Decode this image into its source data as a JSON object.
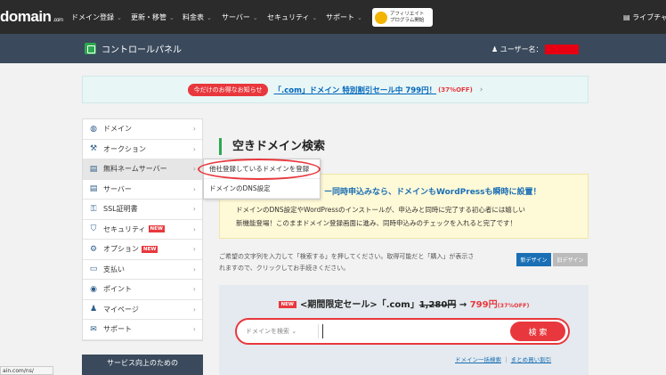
{
  "topnav": {
    "logo_main": "domain",
    "logo_sub": ".com",
    "items": [
      {
        "label": "ドメイン登録"
      },
      {
        "label": "更新・移管"
      },
      {
        "label": "料金表"
      },
      {
        "label": "サーバー"
      },
      {
        "label": "セキュリティ"
      },
      {
        "label": "サポート"
      }
    ],
    "affiliate_line1": "アフィリエイト",
    "affiliate_line2": "プログラム開始",
    "blog": "ライブチャット"
  },
  "cpbar": {
    "title": "コントロールパネル",
    "user_label": "ユーザー名："
  },
  "promo": {
    "badge": "今だけのお得なお知らせ",
    "text": "「.com」ドメイン 特別割引セール中 799円！",
    "off": "(37%OFF)",
    "arrow": "›"
  },
  "sidebar": {
    "items": [
      {
        "label": "ドメイン",
        "icon": "com-icon",
        "glyph": "◍"
      },
      {
        "label": "オークション",
        "icon": "gavel-icon",
        "glyph": "⚒"
      },
      {
        "label": "無料ネームサーバー",
        "icon": "server-icon",
        "glyph": "▤"
      },
      {
        "label": "サーバー",
        "icon": "server-icon",
        "glyph": "▤"
      },
      {
        "label": "SSL証明書",
        "icon": "lock-icon",
        "glyph": "⚿"
      },
      {
        "label": "セキュリティ",
        "icon": "shield-icon",
        "glyph": "⛉",
        "badge": "NEW"
      },
      {
        "label": "オプション",
        "icon": "gear-icon",
        "glyph": "⚙",
        "badge": "NEW"
      },
      {
        "label": "支払い",
        "icon": "card-icon",
        "glyph": "▭"
      },
      {
        "label": "ポイント",
        "icon": "coins-icon",
        "glyph": "◉"
      },
      {
        "label": "マイページ",
        "icon": "user-icon",
        "glyph": "♟"
      },
      {
        "label": "サポート",
        "icon": "mail-icon",
        "glyph": "✉"
      }
    ],
    "footer": "サービス向上のための"
  },
  "flyout": {
    "items": [
      {
        "label": "他社登録しているドメインを登録"
      },
      {
        "label": "ドメインのDNS設定"
      }
    ]
  },
  "main": {
    "title": "空きドメイン検索",
    "notice_head": "ー同時申込みなら、ドメインもWordPressも瞬時に設置！",
    "notice_line1": "ドメインのDNS設定やWordPressのインストールが、申込みと同時に完了する初心者には嬉しい",
    "notice_line2": "新機能登場！このままドメイン登録画面に進み、同時申込みのチェックを入れると完了です！",
    "desc_line1": "ご希望の文字列を入力して「検索する」を押してください。取得可能だと「購入」が表示さ",
    "desc_line2": "れますので、クリックしてお手続きください。",
    "design_new": "新デザイン",
    "design_old": "旧デザイン"
  },
  "search": {
    "new_badge": "NEW",
    "sale_prefix": "<期間限定セール>「.com」",
    "old_price": "1,280円",
    "arrow": " → ",
    "new_price": "799円",
    "off": "(37%OFF)",
    "select_label": "ドメインを検索 ⌄",
    "input_value": "",
    "button": "検 索",
    "link1": "ドメイン一括検索",
    "sep": " ｜ ",
    "link2": "まとめ買い割引"
  },
  "statusbar": {
    "url": "ain.com/ns/"
  },
  "colors": {
    "accent_red": "#e8383d",
    "link_blue": "#1a6fb5",
    "nav_dark": "#2b2b2b",
    "panel_bar": "#3a4a5c",
    "brand_green": "#2da84f"
  }
}
